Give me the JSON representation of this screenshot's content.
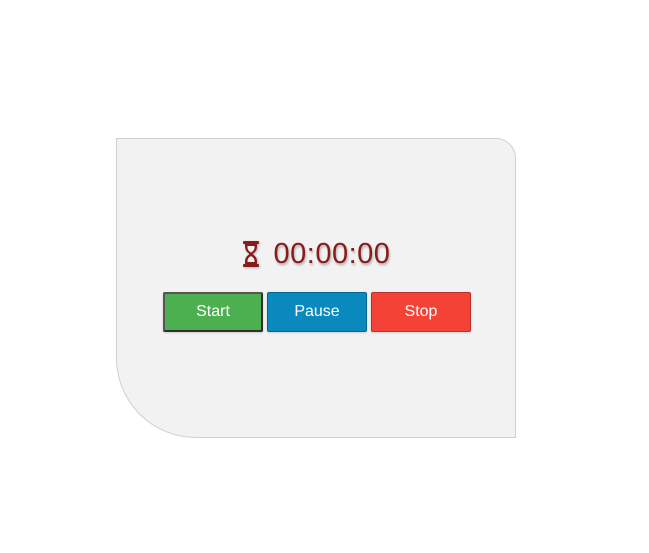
{
  "timer": {
    "display": "00:00:00",
    "icon": "hourglass-icon",
    "time_color": "#8b1a1a"
  },
  "controls": {
    "start_label": "Start",
    "pause_label": "Pause",
    "stop_label": "Stop",
    "start_color": "#4caf50",
    "pause_color": "#0a89bf",
    "stop_color": "#f44336"
  },
  "card": {
    "background": "#f2f2f2"
  }
}
